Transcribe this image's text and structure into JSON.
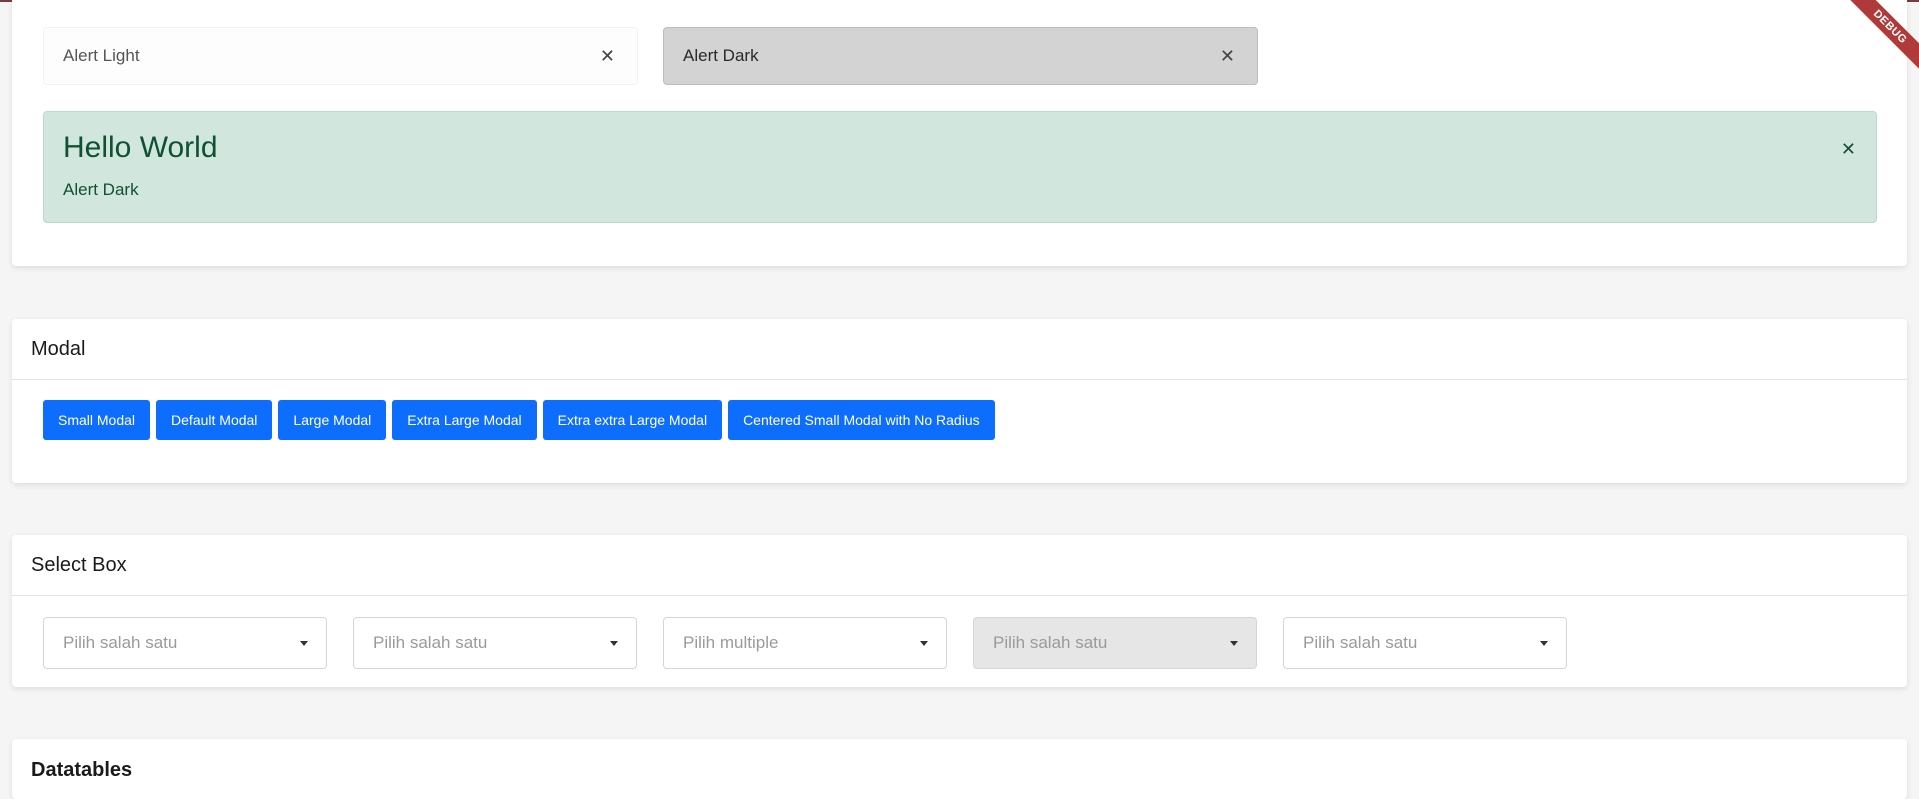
{
  "debug_banner": "DEBUG",
  "alerts": {
    "light": "Alert Light",
    "dark": "Alert Dark",
    "success_heading": "Hello World",
    "success_text": "Alert Dark",
    "close_glyph": "✕"
  },
  "modal": {
    "title": "Modal",
    "buttons": [
      "Small Modal",
      "Default Modal",
      "Large Modal",
      "Extra Large Modal",
      "Extra extra Large Modal",
      "Centered Small Modal with No Radius"
    ]
  },
  "select_box": {
    "title": "Select Box",
    "selects": [
      {
        "placeholder": "Pilih salah satu",
        "disabled": false
      },
      {
        "placeholder": "Pilih salah satu",
        "disabled": false
      },
      {
        "placeholder": "Pilih multiple",
        "disabled": false
      },
      {
        "placeholder": "Pilih salah satu",
        "disabled": true
      },
      {
        "placeholder": "Pilih salah satu",
        "disabled": false
      }
    ]
  },
  "datatables": {
    "title": "Datatables"
  },
  "colors": {
    "primary": "#0d6efd",
    "success_bg": "#d1e7dd",
    "success_text": "#0f5132",
    "dark_bg": "#d3d3d4"
  },
  "icons": {
    "close": "close-icon",
    "caret": "caret-down-icon"
  }
}
